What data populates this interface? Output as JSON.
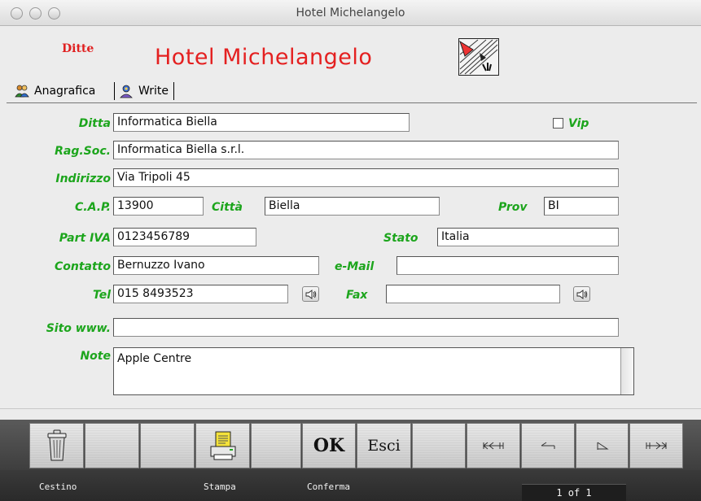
{
  "window": {
    "title": "Hotel Michelangelo"
  },
  "header": {
    "section_label": "Ditte",
    "company_title": "Hotel Michelangelo",
    "logo_icon": "drawing-tools-logo-icon"
  },
  "tabs": [
    {
      "label": "Anagrafica",
      "icon": "people-icon",
      "active": true
    },
    {
      "label": "Write",
      "icon": "write-people-icon",
      "active": false
    }
  ],
  "form": {
    "ditta": {
      "label": "Ditta",
      "value": "Informatica Biella"
    },
    "vip": {
      "label": "Vip",
      "checked": false
    },
    "rag_soc": {
      "label": "Rag.Soc.",
      "value": "Informatica Biella s.r.l."
    },
    "indirizzo": {
      "label": "Indirizzo",
      "value": "Via Tripoli 45"
    },
    "cap": {
      "label": "C.A.P.",
      "value": "13900"
    },
    "citta": {
      "label": "Città",
      "value": "Biella"
    },
    "prov": {
      "label": "Prov",
      "value": "BI"
    },
    "part_iva": {
      "label": "Part IVA",
      "value": "0123456789"
    },
    "stato": {
      "label": "Stato",
      "value": "Italia"
    },
    "contatto": {
      "label": "Contatto",
      "value": "Bernuzzo Ivano"
    },
    "email": {
      "label": "e-Mail",
      "value": ""
    },
    "tel": {
      "label": "Tel",
      "value": "015 8493523"
    },
    "fax": {
      "label": "Fax",
      "value": ""
    },
    "sito": {
      "label": "Sito www.",
      "value": ""
    },
    "note": {
      "label": "Note",
      "value": "Apple Centre"
    }
  },
  "toolbar": {
    "ok_label": "OK",
    "esci_label": "Esci",
    "status_labels": {
      "cestino": "Cestino",
      "stampa": "Stampa",
      "conferma": "Conferma"
    },
    "page_indicator": "1 of 1"
  },
  "colors": {
    "label_green": "#1ca51c",
    "title_red": "#e42020"
  }
}
